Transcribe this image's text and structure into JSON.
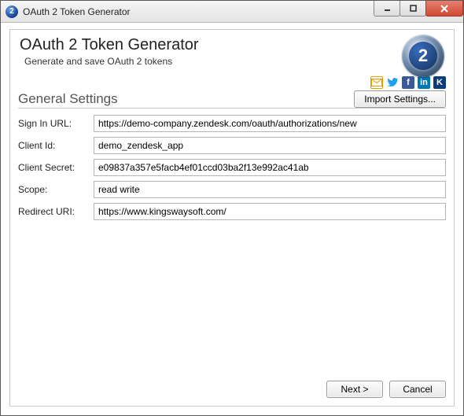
{
  "window": {
    "title": "OAuth 2 Token Generator",
    "app_icon_glyph": "2",
    "min_tooltip": "Minimize",
    "max_tooltip": "Maximize",
    "close_tooltip": "Close"
  },
  "header": {
    "title": "OAuth 2 Token Generator",
    "subtitle": "Generate and save OAuth 2 tokens",
    "badge_glyph": "2",
    "social": {
      "mail": "mail",
      "twitter": "twitter",
      "facebook": "f",
      "linkedin": "in",
      "kingswaysoft": "K"
    }
  },
  "section": {
    "title": "General Settings",
    "import_button": "Import Settings..."
  },
  "form": {
    "signin_url": {
      "label": "Sign In URL:",
      "value": "https://demo-company.zendesk.com/oauth/authorizations/new"
    },
    "client_id": {
      "label": "Client Id:",
      "value": "demo_zendesk_app"
    },
    "client_secret": {
      "label": "Client Secret:",
      "value": "e09837a357e5facb4ef01ccd03ba2f13e992ac41ab"
    },
    "scope": {
      "label": "Scope:",
      "value": "read write"
    },
    "redirect_uri": {
      "label": "Redirect URI:",
      "value": "https://www.kingswaysoft.com/"
    }
  },
  "footer": {
    "next": "Next >",
    "cancel": "Cancel"
  }
}
